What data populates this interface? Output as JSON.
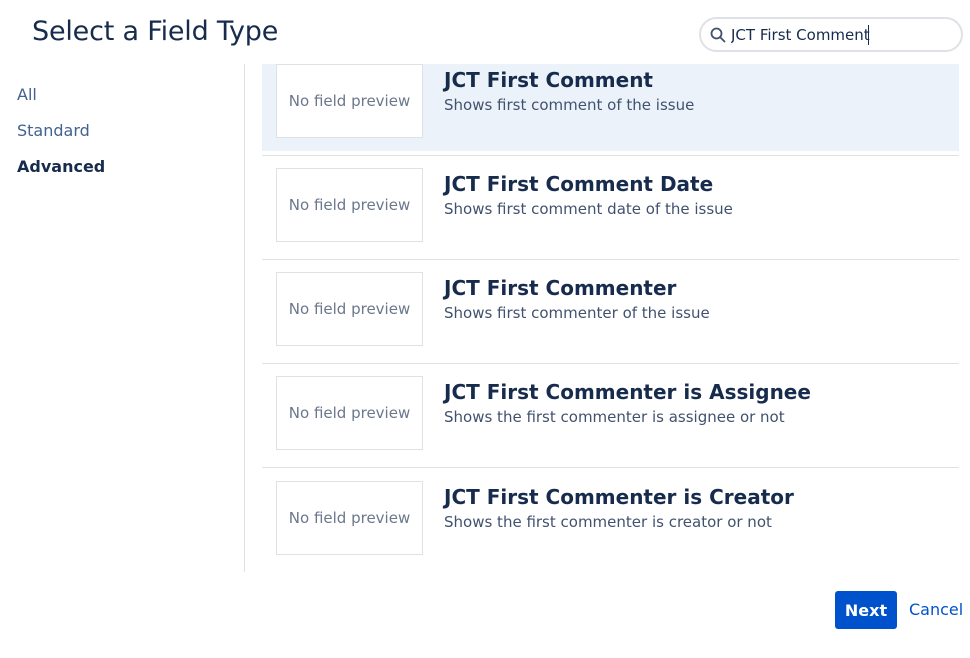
{
  "dialog": {
    "title": "Select a Field Type"
  },
  "search": {
    "value": "JCT First Comment",
    "icon": "search-icon"
  },
  "nav": {
    "items": [
      {
        "label": "All",
        "active": false
      },
      {
        "label": "Standard",
        "active": false
      },
      {
        "label": "Advanced",
        "active": true
      }
    ]
  },
  "results": [
    {
      "preview": "No field preview",
      "title": "JCT First Comment",
      "description": "Shows first comment of the issue",
      "selected": true
    },
    {
      "preview": "No field preview",
      "title": "JCT First Comment Date",
      "description": "Shows first comment date of the issue",
      "selected": false
    },
    {
      "preview": "No field preview",
      "title": "JCT First Commenter",
      "description": "Shows first commenter of the issue",
      "selected": false
    },
    {
      "preview": "No field preview",
      "title": "JCT First Commenter is Assignee",
      "description": "Shows the first commenter is assignee or not",
      "selected": false
    },
    {
      "preview": "No field preview",
      "title": "JCT First Commenter is Creator",
      "description": "Shows the first commenter is creator or not",
      "selected": false
    }
  ],
  "footer": {
    "next_label": "Next",
    "cancel_label": "Cancel"
  },
  "colors": {
    "primary": "#0052CC",
    "selected_bg": "#EBF2FA",
    "text": "#172B4D",
    "nav_link": "#42628F"
  }
}
